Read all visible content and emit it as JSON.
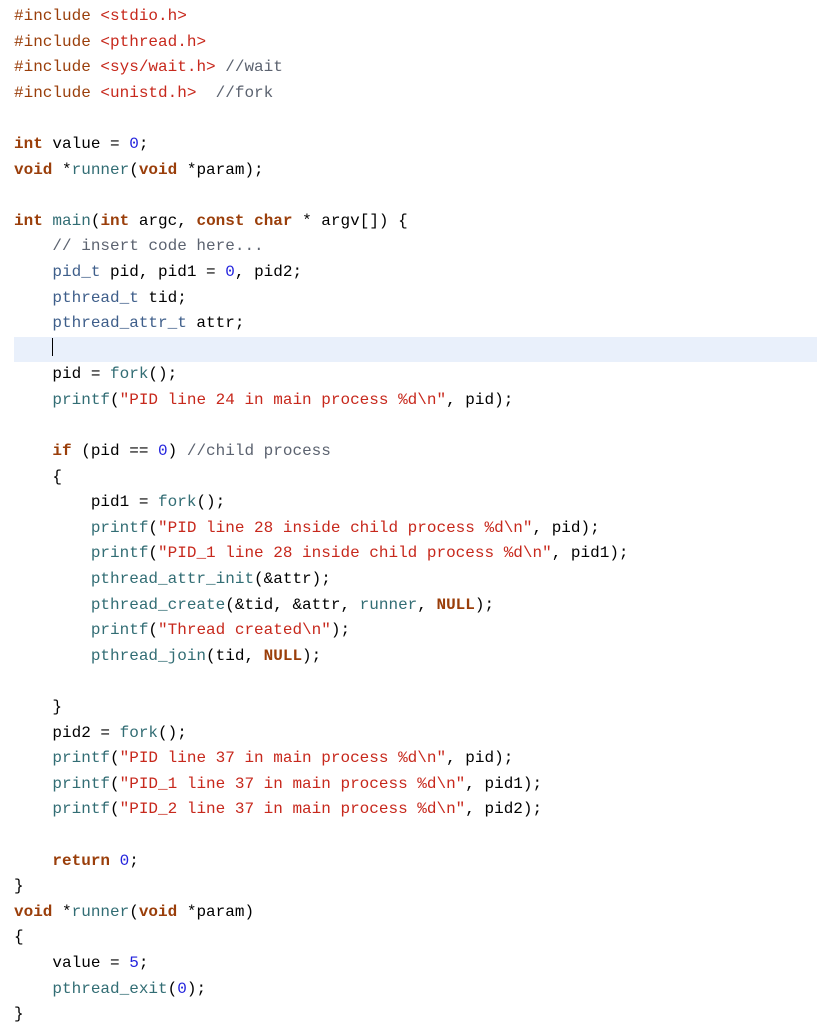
{
  "language": "c",
  "highlighted_line_index": 12,
  "colors": {
    "background": "#ffffff",
    "highlight": "#e9f0fb",
    "keyword": "#9a3e0a",
    "include": "#c7281c",
    "string": "#c7281c",
    "function": "#326d74",
    "type": "#3e5e8a",
    "number": "#2222dd",
    "comment": "#5c6370"
  },
  "code": {
    "lines": [
      "#include <stdio.h>",
      "#include <pthread.h>",
      "#include <sys/wait.h> //wait",
      "#include <unistd.h>  //fork",
      "",
      "int value = 0;",
      "void *runner(void *param);",
      "",
      "int main(int argc, const char * argv[]) {",
      "    // insert code here...",
      "    pid_t pid, pid1 = 0, pid2;",
      "    pthread_t tid;",
      "    pthread_attr_t attr;",
      "    ",
      "    pid = fork();",
      "    printf(\"PID line 24 in main process %d\\n\", pid);",
      "    ",
      "    if (pid == 0) //child process",
      "    {",
      "        pid1 = fork();",
      "        printf(\"PID line 28 inside child process %d\\n\", pid);",
      "        printf(\"PID_1 line 28 inside child process %d\\n\", pid1);",
      "        pthread_attr_init(&attr);",
      "        pthread_create(&tid, &attr, runner, NULL);",
      "        printf(\"Thread created\\n\");",
      "        pthread_join(tid, NULL);",
      "",
      "    }",
      "    pid2 = fork();",
      "    printf(\"PID line 37 in main process %d\\n\", pid);",
      "    printf(\"PID_1 line 37 in main process %d\\n\", pid1);",
      "    printf(\"PID_2 line 37 in main process %d\\n\", pid2);",
      "    ",
      "    return 0;",
      "}",
      "void *runner(void *param)",
      "{",
      "    value = 5;",
      "    pthread_exit(0);",
      "}"
    ]
  },
  "tokens": [
    [
      [
        "#include ",
        "pp"
      ],
      [
        "<stdio.h>",
        "inc"
      ]
    ],
    [
      [
        "#include ",
        "pp"
      ],
      [
        "<pthread.h>",
        "inc"
      ]
    ],
    [
      [
        "#include ",
        "pp"
      ],
      [
        "<sys/wait.h>",
        "inc"
      ],
      [
        " ",
        "op"
      ],
      [
        "//wait",
        "cmt"
      ]
    ],
    [
      [
        "#include ",
        "pp"
      ],
      [
        "<unistd.h>",
        "inc"
      ],
      [
        "  ",
        "op"
      ],
      [
        "//fork",
        "cmt"
      ]
    ],
    [],
    [
      [
        "int",
        "kw"
      ],
      [
        " value = ",
        "id"
      ],
      [
        "0",
        "num"
      ],
      [
        ";",
        "op"
      ]
    ],
    [
      [
        "void",
        "kw"
      ],
      [
        " *",
        "op"
      ],
      [
        "runner",
        "fndef"
      ],
      [
        "(",
        "op"
      ],
      [
        "void",
        "kw"
      ],
      [
        " *param);",
        "id"
      ]
    ],
    [],
    [
      [
        "int",
        "kw"
      ],
      [
        " ",
        "op"
      ],
      [
        "main",
        "fndef"
      ],
      [
        "(",
        "op"
      ],
      [
        "int",
        "kw"
      ],
      [
        " argc, ",
        "id"
      ],
      [
        "const",
        "kw"
      ],
      [
        " ",
        "op"
      ],
      [
        "char",
        "kw"
      ],
      [
        " * argv[]) {",
        "id"
      ]
    ],
    [
      [
        "    ",
        "op"
      ],
      [
        "// insert code here...",
        "cmt"
      ]
    ],
    [
      [
        "    ",
        "op"
      ],
      [
        "pid_t",
        "type"
      ],
      [
        " pid, pid1 = ",
        "id"
      ],
      [
        "0",
        "num"
      ],
      [
        ", pid2;",
        "id"
      ]
    ],
    [
      [
        "    ",
        "op"
      ],
      [
        "pthread_t",
        "type"
      ],
      [
        " tid;",
        "id"
      ]
    ],
    [
      [
        "    ",
        "op"
      ],
      [
        "pthread_attr_t",
        "type"
      ],
      [
        " attr;",
        "id"
      ]
    ],
    [
      [
        "    ",
        "op"
      ],
      [
        "|",
        "cursor"
      ]
    ],
    [
      [
        "    pid = ",
        "id"
      ],
      [
        "fork",
        "fn"
      ],
      [
        "();",
        "op"
      ]
    ],
    [
      [
        "    ",
        "op"
      ],
      [
        "printf",
        "fn"
      ],
      [
        "(",
        "op"
      ],
      [
        "\"PID line 24 in main process %d\\n\"",
        "str"
      ],
      [
        ", pid);",
        "id"
      ]
    ],
    [
      [
        "    ",
        "op"
      ]
    ],
    [
      [
        "    ",
        "op"
      ],
      [
        "if",
        "kw"
      ],
      [
        " (pid == ",
        "id"
      ],
      [
        "0",
        "num"
      ],
      [
        ") ",
        "op"
      ],
      [
        "//child process",
        "cmt"
      ]
    ],
    [
      [
        "    {",
        "op"
      ]
    ],
    [
      [
        "        pid1 = ",
        "id"
      ],
      [
        "fork",
        "fn"
      ],
      [
        "();",
        "op"
      ]
    ],
    [
      [
        "        ",
        "op"
      ],
      [
        "printf",
        "fn"
      ],
      [
        "(",
        "op"
      ],
      [
        "\"PID line 28 inside child process %d\\n\"",
        "str"
      ],
      [
        ", pid);",
        "id"
      ]
    ],
    [
      [
        "        ",
        "op"
      ],
      [
        "printf",
        "fn"
      ],
      [
        "(",
        "op"
      ],
      [
        "\"PID_1 line 28 inside child process %d\\n\"",
        "str"
      ],
      [
        ", pid1);",
        "id"
      ]
    ],
    [
      [
        "        ",
        "op"
      ],
      [
        "pthread_attr_init",
        "fn"
      ],
      [
        "(&attr);",
        "id"
      ]
    ],
    [
      [
        "        ",
        "op"
      ],
      [
        "pthread_create",
        "fn"
      ],
      [
        "(&tid, &attr, ",
        "id"
      ],
      [
        "runner",
        "fn"
      ],
      [
        ", ",
        "op"
      ],
      [
        "NULL",
        "null"
      ],
      [
        ");",
        "op"
      ]
    ],
    [
      [
        "        ",
        "op"
      ],
      [
        "printf",
        "fn"
      ],
      [
        "(",
        "op"
      ],
      [
        "\"Thread created\\n\"",
        "str"
      ],
      [
        ");",
        "op"
      ]
    ],
    [
      [
        "        ",
        "op"
      ],
      [
        "pthread_join",
        "fn"
      ],
      [
        "(tid, ",
        "id"
      ],
      [
        "NULL",
        "null"
      ],
      [
        ");",
        "op"
      ]
    ],
    [],
    [
      [
        "    }",
        "op"
      ]
    ],
    [
      [
        "    pid2 = ",
        "id"
      ],
      [
        "fork",
        "fn"
      ],
      [
        "();",
        "op"
      ]
    ],
    [
      [
        "    ",
        "op"
      ],
      [
        "printf",
        "fn"
      ],
      [
        "(",
        "op"
      ],
      [
        "\"PID line 37 in main process %d\\n\"",
        "str"
      ],
      [
        ", pid);",
        "id"
      ]
    ],
    [
      [
        "    ",
        "op"
      ],
      [
        "printf",
        "fn"
      ],
      [
        "(",
        "op"
      ],
      [
        "\"PID_1 line 37 in main process %d\\n\"",
        "str"
      ],
      [
        ", pid1);",
        "id"
      ]
    ],
    [
      [
        "    ",
        "op"
      ],
      [
        "printf",
        "fn"
      ],
      [
        "(",
        "op"
      ],
      [
        "\"PID_2 line 37 in main process %d\\n\"",
        "str"
      ],
      [
        ", pid2);",
        "id"
      ]
    ],
    [
      [
        "    ",
        "op"
      ]
    ],
    [
      [
        "    ",
        "op"
      ],
      [
        "return",
        "kw"
      ],
      [
        " ",
        "op"
      ],
      [
        "0",
        "num"
      ],
      [
        ";",
        "op"
      ]
    ],
    [
      [
        "}",
        "op"
      ]
    ],
    [
      [
        "void",
        "kw"
      ],
      [
        " *",
        "op"
      ],
      [
        "runner",
        "fndef"
      ],
      [
        "(",
        "op"
      ],
      [
        "void",
        "kw"
      ],
      [
        " *param)",
        "id"
      ]
    ],
    [
      [
        "{",
        "op"
      ]
    ],
    [
      [
        "    value = ",
        "id"
      ],
      [
        "5",
        "num"
      ],
      [
        ";",
        "op"
      ]
    ],
    [
      [
        "    ",
        "op"
      ],
      [
        "pthread_exit",
        "fn"
      ],
      [
        "(",
        "op"
      ],
      [
        "0",
        "num"
      ],
      [
        ");",
        "op"
      ]
    ],
    [
      [
        "}",
        "op"
      ]
    ]
  ]
}
